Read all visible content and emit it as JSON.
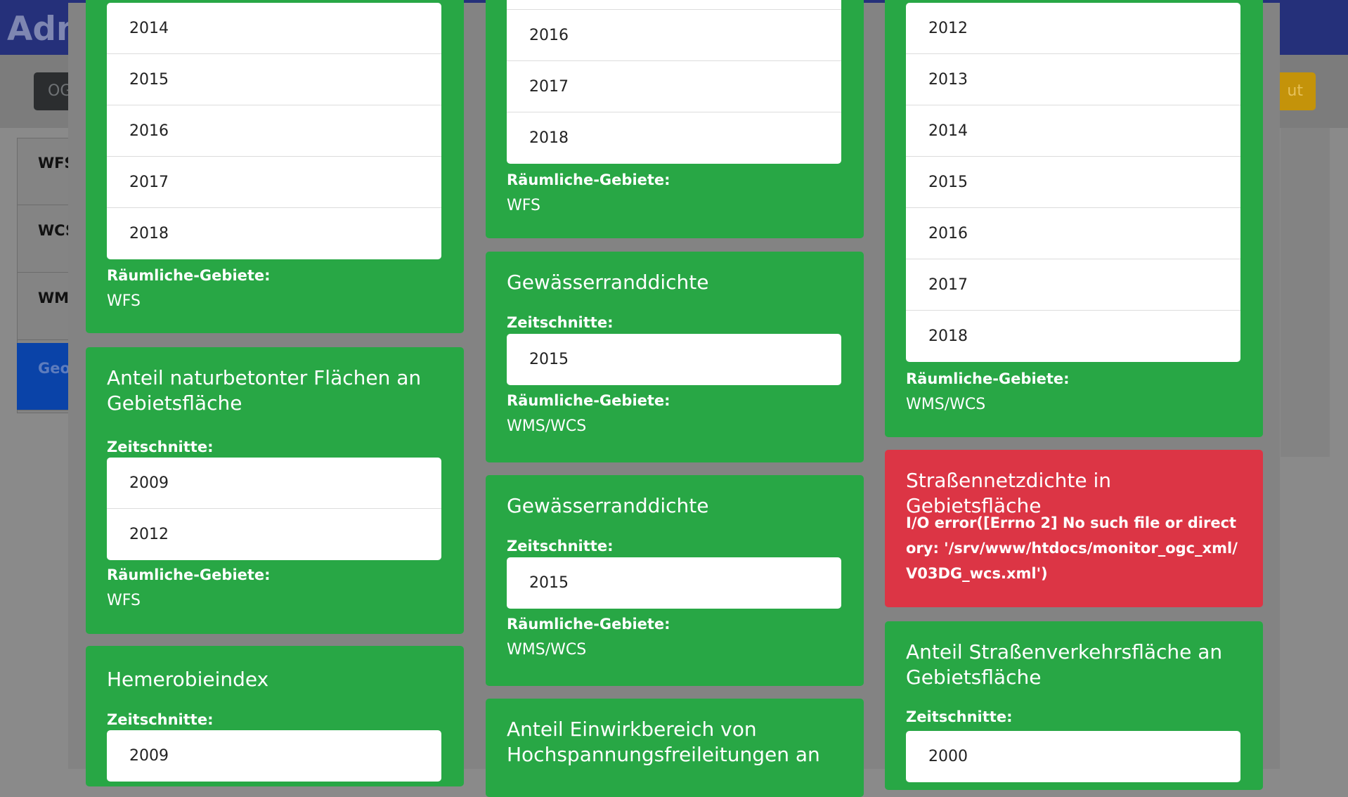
{
  "background": {
    "brand": "Adm",
    "toolbar_left": "OG",
    "toolbar_right": "ut",
    "sidebar": [
      {
        "label": "WFS"
      },
      {
        "label": "WCS"
      },
      {
        "label": "WMS"
      },
      {
        "label": "Geo"
      }
    ]
  },
  "labels": {
    "zeitschnitte": "Zeitschnitte:",
    "raeumliche": "Räumliche-Gebiete:"
  },
  "col1": {
    "card1": {
      "years": [
        "2014",
        "2015",
        "2016",
        "2017",
        "2018"
      ],
      "gebiete": "WFS"
    },
    "card2": {
      "title": "Anteil naturbetonter Flächen an Gebietsfläche",
      "years": [
        "2009",
        "2012"
      ],
      "gebiete": "WFS"
    },
    "card3": {
      "title": "Hemerobieindex",
      "years": [
        "2009"
      ]
    }
  },
  "col2": {
    "card1": {
      "years": [
        "2016",
        "2017",
        "2018"
      ],
      "gebiete": "WFS"
    },
    "card2": {
      "title": "Gewässerranddichte",
      "years": [
        "2015"
      ],
      "gebiete": "WMS/WCS"
    },
    "card3": {
      "title": "Gewässerranddichte",
      "years": [
        "2015"
      ],
      "gebiete": "WMS/WCS"
    },
    "card4": {
      "title": "Anteil Einwirkbereich von Hochspannungsfreileitungen an"
    }
  },
  "col3": {
    "card1": {
      "years": [
        "2012",
        "2013",
        "2014",
        "2015",
        "2016",
        "2017",
        "2018"
      ],
      "gebiete": "WMS/WCS"
    },
    "card2": {
      "title": "Straßennetzdichte in Gebietsfläche",
      "error": "I/O error([Errno 2] No such file or directory: '/srv/www/htdocs/monitor_ogc_xml/V03DG_wcs.xml')"
    },
    "card3": {
      "title": "Anteil Straßenverkehrsfläche an Gebietsfläche",
      "years": [
        "2000"
      ]
    }
  },
  "colors": {
    "success": "#28a745",
    "danger": "#dc3545",
    "primary_dimmed": "#25307a"
  }
}
